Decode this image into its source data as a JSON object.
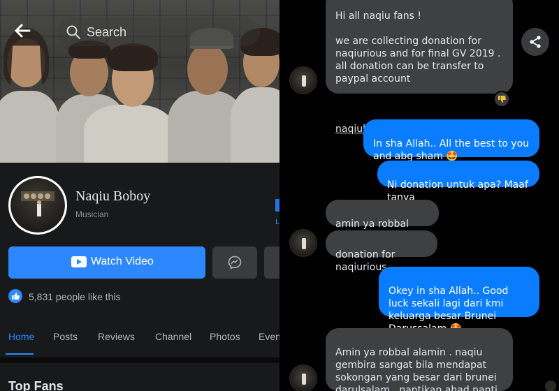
{
  "facebook": {
    "search_placeholder": "Search",
    "page_name": "Naqiu Boboy",
    "category": "Musician",
    "edge_label": "L",
    "watch_button": "Watch Video",
    "likes": "5,831 people like this",
    "tabs": [
      "Home",
      "Posts",
      "Reviews",
      "Channel",
      "Photos",
      "Even"
    ],
    "active_tab": "Home",
    "section_title": "Top Fans",
    "accent_color": "#2d88ff"
  },
  "chat": {
    "messages": [
      {
        "from": "them",
        "text": "Hi all naqiu fans !\n\nwe are collecting donation for naqiurious and for final GV 2019 . all donation can be transfer to paypal account",
        "email": "naqiuboboyofficial@gmail.com"
      },
      {
        "from": "me",
        "text": "In sha Allah.. All the best to you and abg sham 🤩"
      },
      {
        "from": "me",
        "text": "Ni donation untuk apa? Maaf tanya"
      },
      {
        "from": "them",
        "text": "amin ya robbal alamin ."
      },
      {
        "from": "them",
        "text": "donation for naqiurious"
      },
      {
        "from": "me",
        "text": "Okey in sha Allah.. Good luck sekali lagi dari kmi keluarga besar Brunei Darussalam 🤩"
      },
      {
        "from": "them",
        "text": "Amin ya robbal alamin . naqiu gembira sangat bila mendapat sokongan yang besar dari brunei darulsalam . nantikan ahad nanti"
      }
    ],
    "outgoing_color": "#0a7cff",
    "incoming_color": "#3e4042"
  }
}
